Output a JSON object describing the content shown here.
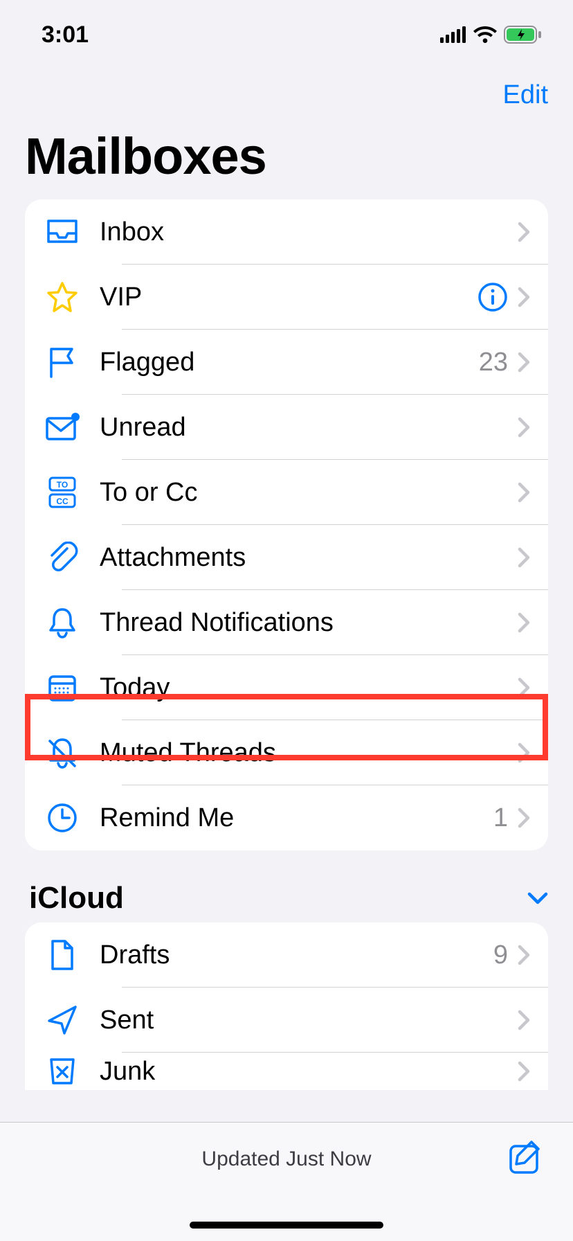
{
  "status": {
    "time": "3:01"
  },
  "nav": {
    "edit": "Edit"
  },
  "title": "Mailboxes",
  "smart_mailboxes": [
    {
      "key": "inbox",
      "label": "Inbox",
      "count": "",
      "info": false,
      "icon": "inbox"
    },
    {
      "key": "vip",
      "label": "VIP",
      "count": "",
      "info": true,
      "icon": "star"
    },
    {
      "key": "flagged",
      "label": "Flagged",
      "count": "23",
      "info": false,
      "icon": "flag"
    },
    {
      "key": "unread",
      "label": "Unread",
      "count": "",
      "info": false,
      "icon": "unread"
    },
    {
      "key": "tocc",
      "label": "To or Cc",
      "count": "",
      "info": false,
      "icon": "tocc"
    },
    {
      "key": "attachments",
      "label": "Attachments",
      "count": "",
      "info": false,
      "icon": "paperclip"
    },
    {
      "key": "thread_notifications",
      "label": "Thread Notifications",
      "count": "",
      "info": false,
      "icon": "bell"
    },
    {
      "key": "today",
      "label": "Today",
      "count": "",
      "info": false,
      "icon": "calendar"
    },
    {
      "key": "muted",
      "label": "Muted Threads",
      "count": "",
      "info": false,
      "icon": "bell-slash"
    },
    {
      "key": "remind_me",
      "label": "Remind Me",
      "count": "1",
      "info": false,
      "icon": "clock",
      "highlight": true
    }
  ],
  "sections": [
    {
      "title": "iCloud",
      "items": [
        {
          "key": "drafts",
          "label": "Drafts",
          "count": "9",
          "icon": "doc"
        },
        {
          "key": "sent",
          "label": "Sent",
          "count": "",
          "icon": "paperplane"
        },
        {
          "key": "junk",
          "label": "Junk",
          "count": "",
          "icon": "junk"
        }
      ]
    }
  ],
  "footer": {
    "status": "Updated Just Now"
  },
  "colors": {
    "accent": "#007aff",
    "star": "#ffcc00",
    "highlight": "#ff3b30",
    "battery": "#34c759"
  }
}
